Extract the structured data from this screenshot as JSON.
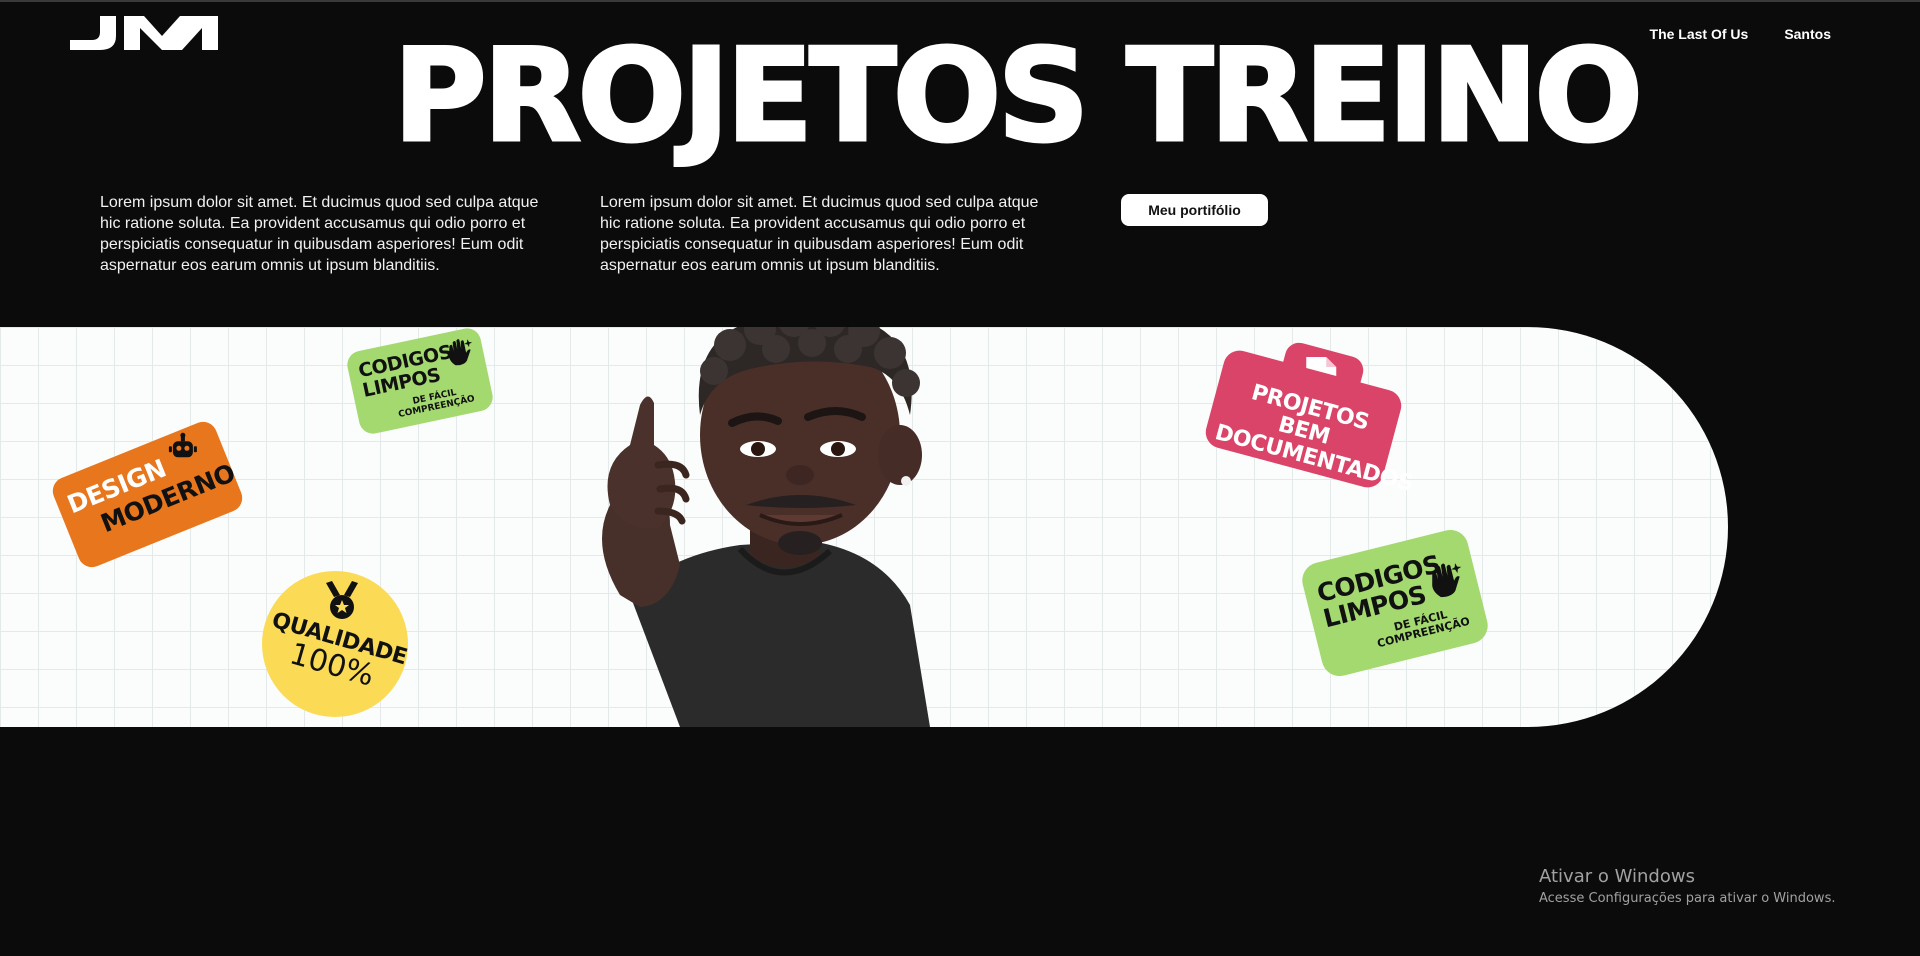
{
  "header": {
    "logo_text": "JM",
    "nav": [
      {
        "label": "The Last Of Us"
      },
      {
        "label": "Santos"
      }
    ]
  },
  "hero": {
    "title": "PROJETOS TREINO",
    "paragraphs": [
      "Lorem ipsum dolor sit amet. Et ducimus quod sed culpa atque hic ratione soluta. Ea provident accusamus qui odio porro et perspiciatis consequatur in quibusdam asperiores! Eum odit aspernatur eos earum omnis ut ipsum blanditiis.",
      "Lorem ipsum dolor sit amet. Et ducimus quod sed culpa atque hic ratione soluta. Ea provident accusamus qui odio porro et perspiciatis consequatur in quibusdam asperiores! Eum odit aspernatur eos earum omnis ut ipsum blanditiis."
    ],
    "portfolio_button": "Meu portifólio"
  },
  "stickers": {
    "clean_code_small": {
      "line1": "CODIGOS",
      "line2": "LIMPOS",
      "sub1": "DE FÁCIL",
      "sub2": "COMPREENÇÃO"
    },
    "design": {
      "line1": "DESIGN",
      "line2": "MODERNO"
    },
    "quality": {
      "line1": "QUALIDADE",
      "line2": "100%"
    },
    "documented": {
      "line1": "PROJETOS BEM",
      "line2": "DOCUMENTADOS"
    },
    "clean_code_big": {
      "line1": "CODIGOS",
      "line2": "LIMPOS",
      "sub1": "DE FÁCIL",
      "sub2": "COMPREENÇÃO"
    }
  },
  "colors": {
    "background": "#0b0b0b",
    "banner": "#fbfcfc",
    "green": "#a3d96f",
    "orange": "#e8761c",
    "yellow": "#fbdb56",
    "pink": "#d94468"
  },
  "watermark": {
    "title": "Ativar o Windows",
    "subtitle": "Acesse Configurações para ativar o Windows."
  }
}
